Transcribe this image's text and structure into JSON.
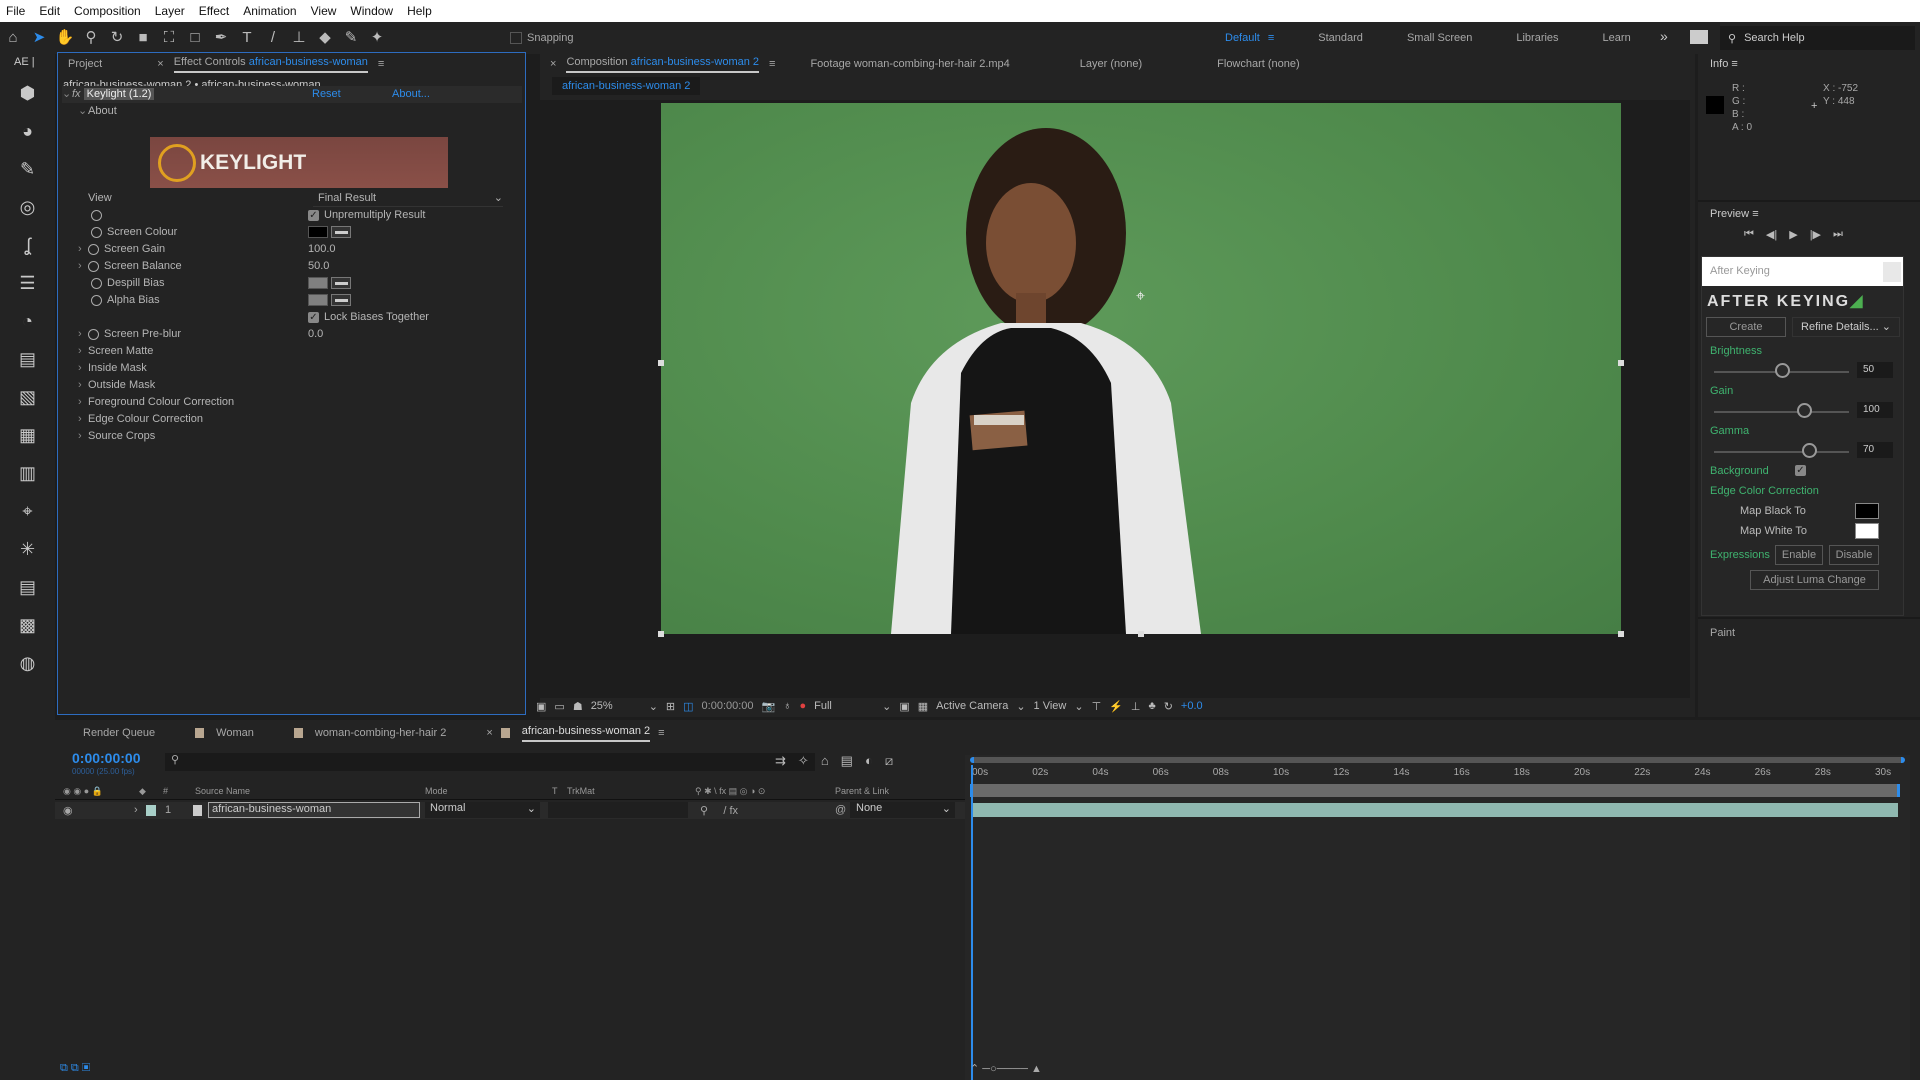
{
  "menu": [
    "File",
    "Edit",
    "Composition",
    "Layer",
    "Effect",
    "Animation",
    "View",
    "Window",
    "Help"
  ],
  "toolbar": {
    "snapping": "Snapping",
    "workspaces": [
      "Default",
      "Standard",
      "Small Screen",
      "Libraries",
      "Learn"
    ],
    "active_workspace": "Default",
    "search_placeholder": "Search Help"
  },
  "left_strip": {
    "label": "AE |",
    "icons": [
      "cube-icon",
      "brain-icon",
      "pen-icon",
      "motion-icon",
      "js-icon",
      "list-icon",
      "speed-icon",
      "doc-icon",
      "image-icon",
      "grid-icon",
      "text-icon",
      "anchor-icon",
      "sparkle-icon",
      "layers-icon",
      "counter-icon",
      "stopwatch-icon"
    ]
  },
  "effect_controls": {
    "tab_project": "Project",
    "tab_label": "Effect Controls",
    "tab_target": "african-business-woman",
    "breadcrumb": "african-business-woman 2 • african-business-woman",
    "effect_name": "Keylight (1.2)",
    "reset": "Reset",
    "about_link": "About...",
    "about_group": "About",
    "logo_text": "KEYLIGHT",
    "view_label": "View",
    "view_value": "Final Result",
    "unpremultiply": "Unpremultiply Result",
    "screen_colour": "Screen Colour",
    "screen_gain": "Screen Gain",
    "screen_gain_value": "100.0",
    "screen_balance": "Screen Balance",
    "screen_balance_value": "50.0",
    "despill_bias": "Despill Bias",
    "alpha_bias": "Alpha Bias",
    "lock_biases": "Lock Biases Together",
    "screen_preblur": "Screen Pre-blur",
    "screen_preblur_value": "0.0",
    "groups": [
      "Screen Matte",
      "Inside Mask",
      "Outside Mask",
      "Foreground Colour Correction",
      "Edge Colour Correction",
      "Source Crops"
    ]
  },
  "composition": {
    "tab_label": "Composition",
    "tab_target": "african-business-woman 2",
    "footage_tab": "Footage woman-combing-her-hair 2.mp4",
    "layer_tab": "Layer (none)",
    "flowchart_tab": "Flowchart (none)",
    "sub_tab": "african-business-woman 2",
    "zoom": "25%",
    "timecode": "0:00:00:00",
    "resolution": "Full",
    "camera": "Active Camera",
    "views": "1 View",
    "exposure": "+0.0"
  },
  "info": {
    "title": "Info",
    "r": "R :",
    "g": "G :",
    "b": "B :",
    "a": "A : 0",
    "x": "X : -752",
    "y": "Y : 448"
  },
  "preview": {
    "title": "Preview"
  },
  "after_keying": {
    "panel_title": "After Keying",
    "logo": "AFTER KEYING",
    "create": "Create",
    "refine": "Refine Details...",
    "brightness_label": "Brightness",
    "brightness": 50,
    "gain_label": "Gain",
    "gain": 100,
    "gamma_label": "Gamma",
    "gamma": 70,
    "background_label": "Background",
    "edge_label": "Edge Color Correction",
    "map_black": "Map Black To",
    "map_white": "Map White To",
    "expressions_label": "Expressions",
    "enable": "Enable",
    "disable": "Disable",
    "adjust_luma": "Adjust Luma Change"
  },
  "paint": {
    "title": "Paint"
  },
  "timeline": {
    "tabs": [
      "Render Queue",
      "Woman",
      "woman-combing-her-hair 2",
      "african-business-woman 2"
    ],
    "timecode": "0:00:00:00",
    "fps": "00000 (25.00 fps)",
    "headers": {
      "num": "#",
      "source": "Source Name",
      "mode": "Mode",
      "t": "T",
      "trkmat": "TrkMat",
      "parent": "Parent & Link"
    },
    "layer": {
      "num": "1",
      "name": "african-business-woman",
      "mode": "Normal",
      "parent": "None"
    },
    "ruler": [
      "00s",
      "02s",
      "04s",
      "06s",
      "08s",
      "10s",
      "12s",
      "14s",
      "16s",
      "18s",
      "20s",
      "22s",
      "24s",
      "26s",
      "28s",
      "30s"
    ]
  },
  "colors": {
    "accent": "#2d8ceb",
    "green_screen": "#4f8a4c",
    "after_keying_label": "#3fb36f",
    "layer_bar": "#8fb8b0"
  }
}
